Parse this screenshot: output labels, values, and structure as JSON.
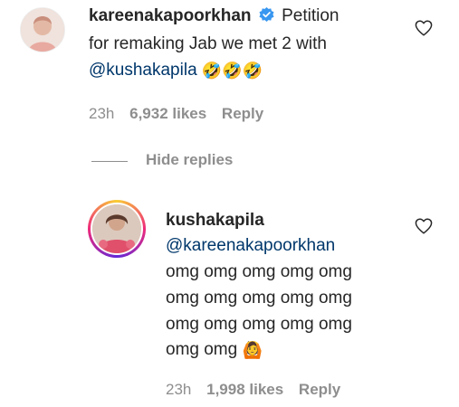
{
  "comment": {
    "username": "kareenakapoorkhan",
    "verified": true,
    "text_line1": "Petition",
    "text_line2": "for remaking Jab we met 2 with",
    "mention": "@kushakapila",
    "emojis": "🤣🤣🤣",
    "time": "23h",
    "likes": "6,932 likes",
    "reply_label": "Reply"
  },
  "hide_replies_label": "Hide replies",
  "reply": {
    "username": "kushakapila",
    "mention": "@kareenakapoorkhan",
    "lines": [
      "omg omg omg omg omg",
      "omg omg omg omg omg",
      "omg omg omg omg omg",
      "omg omg"
    ],
    "emoji": "🙆",
    "time": "23h",
    "likes": "1,998 likes",
    "reply_label": "Reply"
  },
  "colors": {
    "verified": "#3897f0",
    "mention": "#00376b",
    "muted": "#8e8e8e"
  },
  "icons": [
    "heart-outline-icon",
    "verified-badge-icon"
  ]
}
